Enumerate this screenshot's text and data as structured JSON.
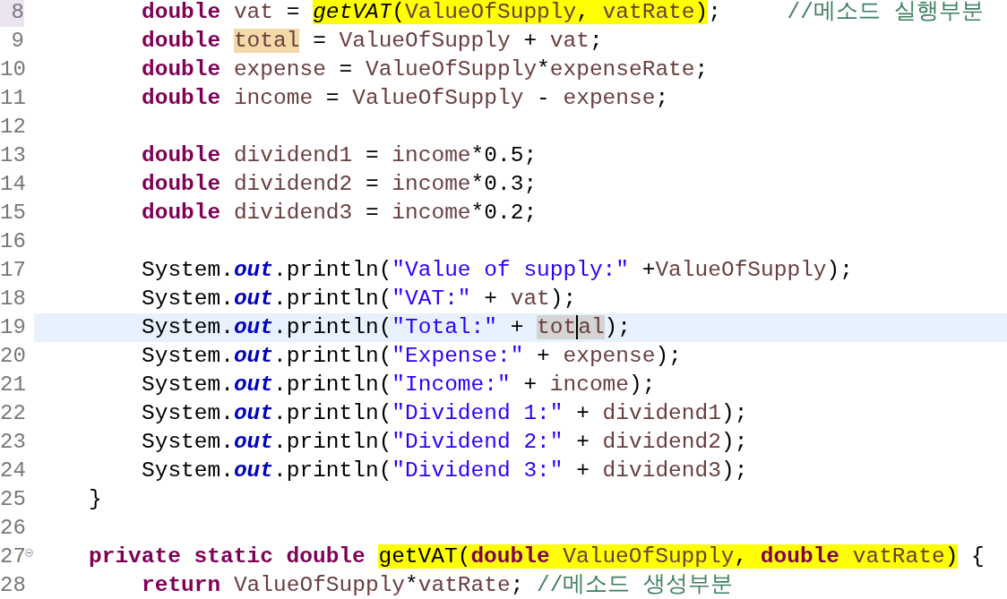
{
  "editor": {
    "lines": [
      {
        "number": "8",
        "marked": true,
        "current": false,
        "foldable": false,
        "kind": "body",
        "tokens": [
          {
            "text": "double ",
            "kind": "keyword"
          },
          {
            "text": "vat",
            "kind": "local"
          },
          {
            "text": " = ",
            "kind": "plain"
          },
          {
            "text": "getVAT",
            "kind": "method",
            "match": true
          },
          {
            "text": "(",
            "kind": "plain",
            "match": true
          },
          {
            "text": "ValueOfSupply",
            "kind": "local",
            "match": true
          },
          {
            "text": ", ",
            "kind": "plain",
            "match": true
          },
          {
            "text": "vatRate",
            "kind": "local",
            "match": true
          },
          {
            "text": ")",
            "kind": "plain",
            "match": true
          },
          {
            "text": ";     ",
            "kind": "plain"
          },
          {
            "text": "//메소드 실행부분",
            "kind": "comment"
          }
        ]
      },
      {
        "number": "9",
        "marked": false,
        "current": false,
        "foldable": false,
        "kind": "body",
        "tokens": [
          {
            "text": "double ",
            "kind": "keyword"
          },
          {
            "text": "total",
            "kind": "local",
            "write_occurrence": true
          },
          {
            "text": " = ",
            "kind": "plain"
          },
          {
            "text": "ValueOfSupply",
            "kind": "local"
          },
          {
            "text": " + ",
            "kind": "plain"
          },
          {
            "text": "vat",
            "kind": "local"
          },
          {
            "text": ";",
            "kind": "plain"
          }
        ]
      },
      {
        "number": "10",
        "marked": false,
        "current": false,
        "foldable": false,
        "kind": "body",
        "tokens": [
          {
            "text": "double ",
            "kind": "keyword"
          },
          {
            "text": "expense",
            "kind": "local"
          },
          {
            "text": " = ",
            "kind": "plain"
          },
          {
            "text": "ValueOfSupply",
            "kind": "local"
          },
          {
            "text": "*",
            "kind": "plain"
          },
          {
            "text": "expenseRate",
            "kind": "local"
          },
          {
            "text": ";",
            "kind": "plain"
          }
        ]
      },
      {
        "number": "11",
        "marked": false,
        "current": false,
        "foldable": false,
        "kind": "body",
        "tokens": [
          {
            "text": "double ",
            "kind": "keyword"
          },
          {
            "text": "income",
            "kind": "local"
          },
          {
            "text": " = ",
            "kind": "plain"
          },
          {
            "text": "ValueOfSupply",
            "kind": "local"
          },
          {
            "text": " - ",
            "kind": "plain"
          },
          {
            "text": "expense",
            "kind": "local"
          },
          {
            "text": ";",
            "kind": "plain"
          }
        ]
      },
      {
        "number": "12",
        "marked": false,
        "current": false,
        "foldable": false
      },
      {
        "number": "13",
        "marked": false,
        "current": false,
        "foldable": false,
        "kind": "body",
        "tokens": [
          {
            "text": "double ",
            "kind": "keyword"
          },
          {
            "text": "dividend1",
            "kind": "local"
          },
          {
            "text": " = ",
            "kind": "plain"
          },
          {
            "text": "income",
            "kind": "local"
          },
          {
            "text": "*0.5;",
            "kind": "plain"
          }
        ]
      },
      {
        "number": "14",
        "marked": false,
        "current": false,
        "foldable": false,
        "kind": "body",
        "tokens": [
          {
            "text": "double ",
            "kind": "keyword"
          },
          {
            "text": "dividend2",
            "kind": "local"
          },
          {
            "text": " = ",
            "kind": "plain"
          },
          {
            "text": "income",
            "kind": "local"
          },
          {
            "text": "*0.3;",
            "kind": "plain"
          }
        ]
      },
      {
        "number": "15",
        "marked": false,
        "current": false,
        "foldable": false,
        "kind": "body",
        "tokens": [
          {
            "text": "double ",
            "kind": "keyword"
          },
          {
            "text": "dividend3",
            "kind": "local"
          },
          {
            "text": " = ",
            "kind": "plain"
          },
          {
            "text": "income",
            "kind": "local"
          },
          {
            "text": "*0.2;",
            "kind": "plain"
          }
        ]
      },
      {
        "number": "16",
        "marked": false,
        "current": false,
        "foldable": false
      },
      {
        "number": "17",
        "marked": false,
        "current": false,
        "foldable": false,
        "kind": "body",
        "tokens": [
          {
            "text": "System.",
            "kind": "plain"
          },
          {
            "text": "out",
            "kind": "field"
          },
          {
            "text": ".println(",
            "kind": "plain"
          },
          {
            "text": "\"Value of supply:\"",
            "kind": "string"
          },
          {
            "text": " +",
            "kind": "plain"
          },
          {
            "text": "ValueOfSupply",
            "kind": "local"
          },
          {
            "text": ");",
            "kind": "plain"
          }
        ]
      },
      {
        "number": "18",
        "marked": false,
        "current": false,
        "foldable": false,
        "kind": "body",
        "tokens": [
          {
            "text": "System.",
            "kind": "plain"
          },
          {
            "text": "out",
            "kind": "field"
          },
          {
            "text": ".println(",
            "kind": "plain"
          },
          {
            "text": "\"VAT:\"",
            "kind": "string"
          },
          {
            "text": " + ",
            "kind": "plain"
          },
          {
            "text": "vat",
            "kind": "local"
          },
          {
            "text": ");",
            "kind": "plain"
          }
        ]
      },
      {
        "number": "19",
        "marked": false,
        "current": true,
        "foldable": false,
        "kind": "body",
        "tokens": [
          {
            "text": "System.",
            "kind": "plain"
          },
          {
            "text": "out",
            "kind": "field"
          },
          {
            "text": ".println(",
            "kind": "plain"
          },
          {
            "text": "\"Total:\"",
            "kind": "string"
          },
          {
            "text": " + ",
            "kind": "plain"
          },
          {
            "text": "tot",
            "kind": "local",
            "read_occurrence": true,
            "caret_after": true
          },
          {
            "text": "al",
            "kind": "local",
            "read_occurrence": true
          },
          {
            "text": ");",
            "kind": "plain"
          }
        ]
      },
      {
        "number": "20",
        "marked": false,
        "current": false,
        "foldable": false,
        "kind": "body",
        "tokens": [
          {
            "text": "System.",
            "kind": "plain"
          },
          {
            "text": "out",
            "kind": "field"
          },
          {
            "text": ".println(",
            "kind": "plain"
          },
          {
            "text": "\"Expense:\"",
            "kind": "string"
          },
          {
            "text": " + ",
            "kind": "plain"
          },
          {
            "text": "expense",
            "kind": "local"
          },
          {
            "text": ");",
            "kind": "plain"
          }
        ]
      },
      {
        "number": "21",
        "marked": false,
        "current": false,
        "foldable": false,
        "kind": "body",
        "tokens": [
          {
            "text": "System.",
            "kind": "plain"
          },
          {
            "text": "out",
            "kind": "field"
          },
          {
            "text": ".println(",
            "kind": "plain"
          },
          {
            "text": "\"Income:\"",
            "kind": "string"
          },
          {
            "text": " + ",
            "kind": "plain"
          },
          {
            "text": "income",
            "kind": "local"
          },
          {
            "text": ");",
            "kind": "plain"
          }
        ]
      },
      {
        "number": "22",
        "marked": false,
        "current": false,
        "foldable": false,
        "kind": "body",
        "tokens": [
          {
            "text": "System.",
            "kind": "plain"
          },
          {
            "text": "out",
            "kind": "field"
          },
          {
            "text": ".println(",
            "kind": "plain"
          },
          {
            "text": "\"Dividend 1:\"",
            "kind": "string"
          },
          {
            "text": " + ",
            "kind": "plain"
          },
          {
            "text": "dividend1",
            "kind": "local"
          },
          {
            "text": ");",
            "kind": "plain"
          }
        ]
      },
      {
        "number": "23",
        "marked": false,
        "current": false,
        "foldable": false,
        "kind": "body",
        "tokens": [
          {
            "text": "System.",
            "kind": "plain"
          },
          {
            "text": "out",
            "kind": "field"
          },
          {
            "text": ".println(",
            "kind": "plain"
          },
          {
            "text": "\"Dividend 2:\"",
            "kind": "string"
          },
          {
            "text": " + ",
            "kind": "plain"
          },
          {
            "text": "dividend2",
            "kind": "local"
          },
          {
            "text": ");",
            "kind": "plain"
          }
        ]
      },
      {
        "number": "24",
        "marked": false,
        "current": false,
        "foldable": false,
        "kind": "body",
        "tokens": [
          {
            "text": "System.",
            "kind": "plain"
          },
          {
            "text": "out",
            "kind": "field"
          },
          {
            "text": ".println(",
            "kind": "plain"
          },
          {
            "text": "\"Dividend 3:\"",
            "kind": "string"
          },
          {
            "text": " + ",
            "kind": "plain"
          },
          {
            "text": "dividend3",
            "kind": "local"
          },
          {
            "text": ");",
            "kind": "plain"
          }
        ]
      },
      {
        "number": "25",
        "marked": false,
        "current": false,
        "foldable": false,
        "kind": "member",
        "tokens": [
          {
            "text": "}",
            "kind": "plain"
          }
        ]
      },
      {
        "number": "26",
        "marked": false,
        "current": false,
        "foldable": false
      },
      {
        "number": "27",
        "marked": false,
        "current": false,
        "foldable": true,
        "kind": "member",
        "tokens": [
          {
            "text": "private static double ",
            "kind": "keyword"
          },
          {
            "text": "getVAT(",
            "kind": "plain",
            "match": true
          },
          {
            "text": "double",
            "kind": "keyword",
            "match": true
          },
          {
            "text": " ValueOfSupply",
            "kind": "local",
            "match": true
          },
          {
            "text": ", ",
            "kind": "plain",
            "match": true
          },
          {
            "text": "double",
            "kind": "keyword",
            "match": true
          },
          {
            "text": " vatRate",
            "kind": "local",
            "match": true
          },
          {
            "text": ")",
            "kind": "plain",
            "match": true
          },
          {
            "text": " {",
            "kind": "plain"
          }
        ]
      },
      {
        "number": "28",
        "marked": false,
        "current": false,
        "foldable": false,
        "kind": "body",
        "tokens": [
          {
            "text": "return ",
            "kind": "keyword"
          },
          {
            "text": "ValueOfSupply",
            "kind": "local"
          },
          {
            "text": "*",
            "kind": "plain"
          },
          {
            "text": "vatRate",
            "kind": "local"
          },
          {
            "text": "; ",
            "kind": "plain"
          },
          {
            "text": "//메소드 생성부분",
            "kind": "comment"
          }
        ]
      }
    ]
  }
}
